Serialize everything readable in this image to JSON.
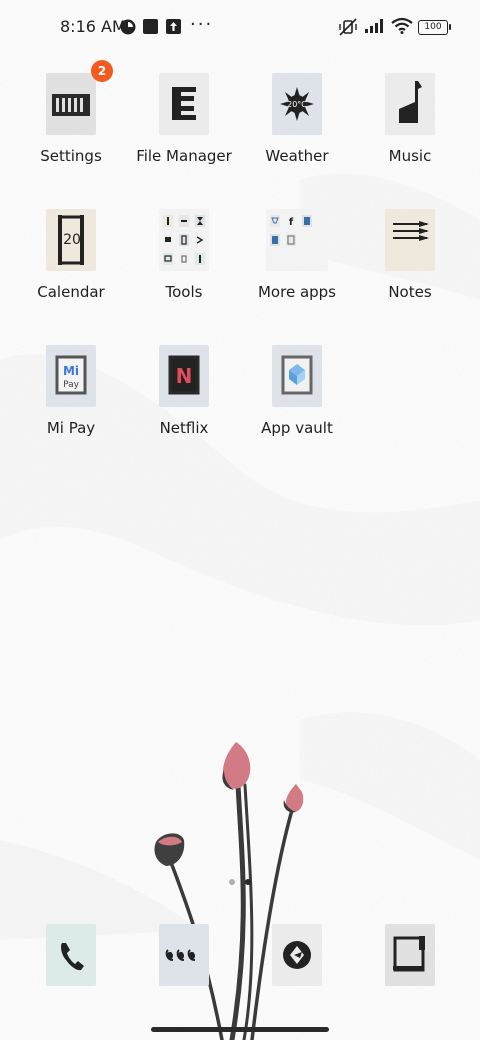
{
  "status_bar": {
    "time": "8:16 AM",
    "battery": "100",
    "more": "···"
  },
  "apps": [
    {
      "label": "Settings",
      "icon": "settings-icon",
      "badge": "2"
    },
    {
      "label": "File Manager",
      "icon": "file-manager-icon"
    },
    {
      "label": "Weather",
      "icon": "weather-icon",
      "temp": "20°C"
    },
    {
      "label": "Music",
      "icon": "music-icon"
    },
    {
      "label": "Calendar",
      "icon": "calendar-icon",
      "day": "20"
    },
    {
      "label": "Tools",
      "icon": "tools-folder-icon"
    },
    {
      "label": "More apps",
      "icon": "more-apps-folder-icon"
    },
    {
      "label": "Notes",
      "icon": "notes-icon"
    },
    {
      "label": "Mi Pay",
      "icon": "mi-pay-icon",
      "brand_top": "Mi",
      "brand_bottom": "Pay"
    },
    {
      "label": "Netflix",
      "icon": "netflix-icon",
      "brand": "N"
    },
    {
      "label": "App vault",
      "icon": "app-vault-icon"
    }
  ],
  "dock": [
    {
      "icon": "phone-icon"
    },
    {
      "icon": "messages-icon"
    },
    {
      "icon": "browser-icon"
    },
    {
      "icon": "camera-icon"
    }
  ],
  "colors": {
    "badge": "#f25a1f",
    "flower": "#d27b84",
    "stem": "#3a3a3a"
  },
  "pager": {
    "pages": 2,
    "current": 2
  }
}
